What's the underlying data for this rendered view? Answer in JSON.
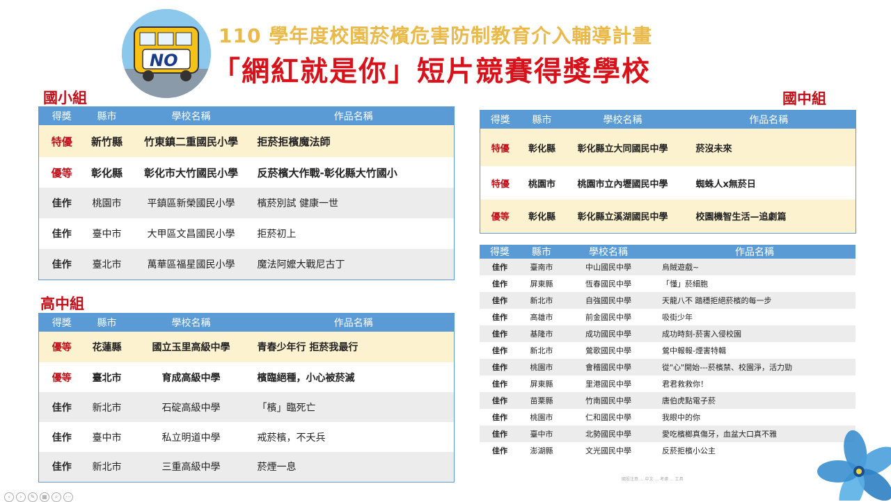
{
  "header": {
    "logo_text": "NO",
    "title_line1": "110 學年度校園菸檳危害防制教育介入輔導計畫",
    "title_line2": "「網紅就是你」短片競賽得獎學校"
  },
  "colors": {
    "header_blue": "#5b9bd5",
    "title_red": "#d8121a",
    "title_gold": "#e9b94a",
    "highlight": "#fdf2d0"
  },
  "elementary": {
    "group_label": "國小組",
    "headers": [
      "得獎",
      "縣市",
      "學校名稱",
      "作品名稱"
    ],
    "rows": [
      {
        "award": "特優",
        "city": "新竹縣",
        "school": "竹東鎮二重國民小學",
        "work": "拒菸拒檳魔法師"
      },
      {
        "award": "優等",
        "city": "彰化縣",
        "school": "彰化市大竹國民小學",
        "work": "反菸檳大作戰-彰化縣大竹國小"
      },
      {
        "award": "佳作",
        "city": "桃園市",
        "school": "平鎮區新榮國民小學",
        "work": "檳菸別試 健康一世"
      },
      {
        "award": "佳作",
        "city": "臺中市",
        "school": "大甲區文昌國民小學",
        "work": "拒菸初上"
      },
      {
        "award": "佳作",
        "city": "臺北市",
        "school": "萬華區福星國民小學",
        "work": "魔法阿嬤大戰尼古丁"
      }
    ]
  },
  "senior": {
    "group_label": "高中組",
    "headers": [
      "得獎",
      "縣市",
      "學校名稱",
      "作品名稱"
    ],
    "rows": [
      {
        "award": "優等",
        "city": "花蓮縣",
        "school": "國立玉里高級中學",
        "work": "青春少年行 拒菸我最行"
      },
      {
        "award": "優等",
        "city": "臺北市",
        "school": "育成高級中學",
        "work": "檳臨絕種，小心被菸滅"
      },
      {
        "award": "佳作",
        "city": "新北市",
        "school": "石碇高級中學",
        "work": "「檳」臨死亡"
      },
      {
        "award": "佳作",
        "city": "臺中市",
        "school": "私立明道中學",
        "work": "戒菸檳，不夭兵"
      },
      {
        "award": "佳作",
        "city": "新北市",
        "school": "三重高級中學",
        "work": "菸煙一息"
      }
    ]
  },
  "junior": {
    "group_label": "國中組",
    "headers": [
      "得獎",
      "縣市",
      "學校名稱",
      "作品名稱"
    ],
    "top_rows": [
      {
        "award": "特優",
        "city": "彰化縣",
        "school": "彰化縣立大同國民中學",
        "work": "菸沒未來"
      },
      {
        "award": "特優",
        "city": "桃園市",
        "school": "桃園市立內壢國民中學",
        "work": "蜘蛛人x無菸日"
      },
      {
        "award": "優等",
        "city": "彰化縣",
        "school": "彰化縣立溪湖國民中學",
        "work": "校園機智生活—追劇篇"
      }
    ],
    "merit_headers": [
      "得獎",
      "縣市",
      "學校名稱",
      "作品名稱"
    ],
    "merit_rows": [
      {
        "award": "佳作",
        "city": "臺南市",
        "school": "中山國民中學",
        "work": "烏賊遊戲~"
      },
      {
        "award": "佳作",
        "city": "屏東縣",
        "school": "恆春國民中學",
        "work": "「懂」菸細胞"
      },
      {
        "award": "佳作",
        "city": "新北市",
        "school": "自強國民中學",
        "work": "天龍八不 踏穩拒絕菸檳的每一步"
      },
      {
        "award": "佳作",
        "city": "高雄市",
        "school": "前金國民中學",
        "work": "吸街少年"
      },
      {
        "award": "佳作",
        "city": "基隆市",
        "school": "成功國民中學",
        "work": "成功時刻-菸害入侵校園"
      },
      {
        "award": "佳作",
        "city": "新北市",
        "school": "鶯歌國民中學",
        "work": "鶯中報報-煙害特輯"
      },
      {
        "award": "佳作",
        "city": "桃園市",
        "school": "會稽國民中學",
        "work": "從\"心\"開始---菸檳禁、校園淨，活力勁"
      },
      {
        "award": "佳作",
        "city": "屏東縣",
        "school": "里港國民中學",
        "work": "君君救救你！"
      },
      {
        "award": "佳作",
        "city": "苗栗縣",
        "school": "竹南國民中學",
        "work": "唐伯虎點電子菸"
      },
      {
        "award": "佳作",
        "city": "桃園市",
        "school": "仁和國民中學",
        "work": "我眼中的你"
      },
      {
        "award": "佳作",
        "city": "臺中市",
        "school": "北勢國民中學",
        "work": "愛吃檳榔真傷牙，血盆大口真不雅"
      },
      {
        "award": "佳作",
        "city": "澎湖縣",
        "school": "文光國民中學",
        "work": "反菸拒檳小公主"
      }
    ]
  },
  "footer": {
    "note": "國投注意 ... 中文 ... 考慮 ... 工具"
  }
}
